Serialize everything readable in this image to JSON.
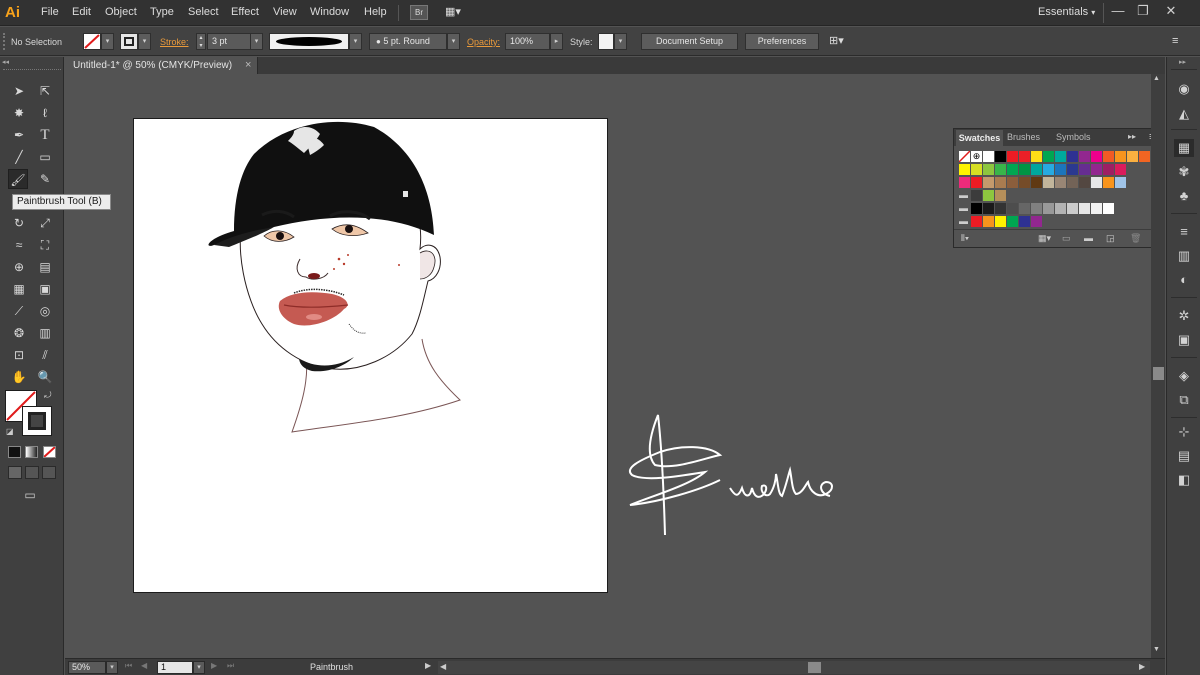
{
  "app": {
    "logo": "Ai"
  },
  "menu": [
    "File",
    "Edit",
    "Object",
    "Type",
    "Select",
    "Effect",
    "View",
    "Window",
    "Help"
  ],
  "workspace": {
    "label": "Essentials",
    "arrow": "▾"
  },
  "window_controls": {
    "minimize": "—",
    "restore": "❐",
    "close": "✕"
  },
  "control_bar": {
    "selection": "No Selection",
    "stroke_label": "Stroke:",
    "stroke_weight": "3 pt",
    "brush": "5 pt. Round",
    "opacity_label": "Opacity:",
    "opacity_value": "100%",
    "style_label": "Style:",
    "document_setup": "Document Setup",
    "preferences": "Preferences"
  },
  "document_tab": {
    "title": "Untitled-1* @ 50% (CMYK/Preview)",
    "close": "×"
  },
  "tooltip": {
    "text": "Paintbrush Tool (B)"
  },
  "swatches_panel": {
    "tabs": [
      "Swatches",
      "Brushes",
      "Symbols"
    ],
    "menu_icon": "≡",
    "collapse": "▸▸",
    "colors": {
      "row1": [
        "#ffffff",
        "#000000",
        "#ed1c24",
        "#ec2027",
        "#ffde17",
        "#00a651",
        "#00a99d",
        "#2e3192",
        "#92278f",
        "#ec008c",
        "#f15a24",
        "#f7941d",
        "#fbb040",
        "#f26522"
      ],
      "row2": [
        "#fff200",
        "#d7df23",
        "#8dc63f",
        "#39b54a",
        "#00a651",
        "#009444",
        "#00a79d",
        "#27aae1",
        "#1c75bc",
        "#2b3990",
        "#662d91",
        "#92278f",
        "#9e1f63",
        "#da1c5c"
      ],
      "row3": [
        "#ee2a7b",
        "#ed1c24",
        "#c49a6c",
        "#a97c50",
        "#8b5e3c",
        "#754c29",
        "#603913",
        "#c2b59b",
        "#998675",
        "#736357",
        "#534741",
        "#e6e7e8",
        "#f7941d",
        "#a0c4e8"
      ],
      "row4": [
        "#3c3c3c",
        "#8dc63f",
        "#b58f5a"
      ],
      "row5": [
        "#000000",
        "#1a1a1a",
        "#333333",
        "#4d4d4d",
        "#666666",
        "#808080",
        "#999999",
        "#b3b3b3",
        "#cccccc",
        "#e6e6e6",
        "#f2f2f2",
        "#ffffff"
      ],
      "row6": [
        "#ed1c24",
        "#f7941d",
        "#fff200",
        "#00a651",
        "#2e3192",
        "#92278f"
      ]
    }
  },
  "status_bar": {
    "zoom": "50%",
    "artboard": "1",
    "tool": "Paintbrush"
  }
}
